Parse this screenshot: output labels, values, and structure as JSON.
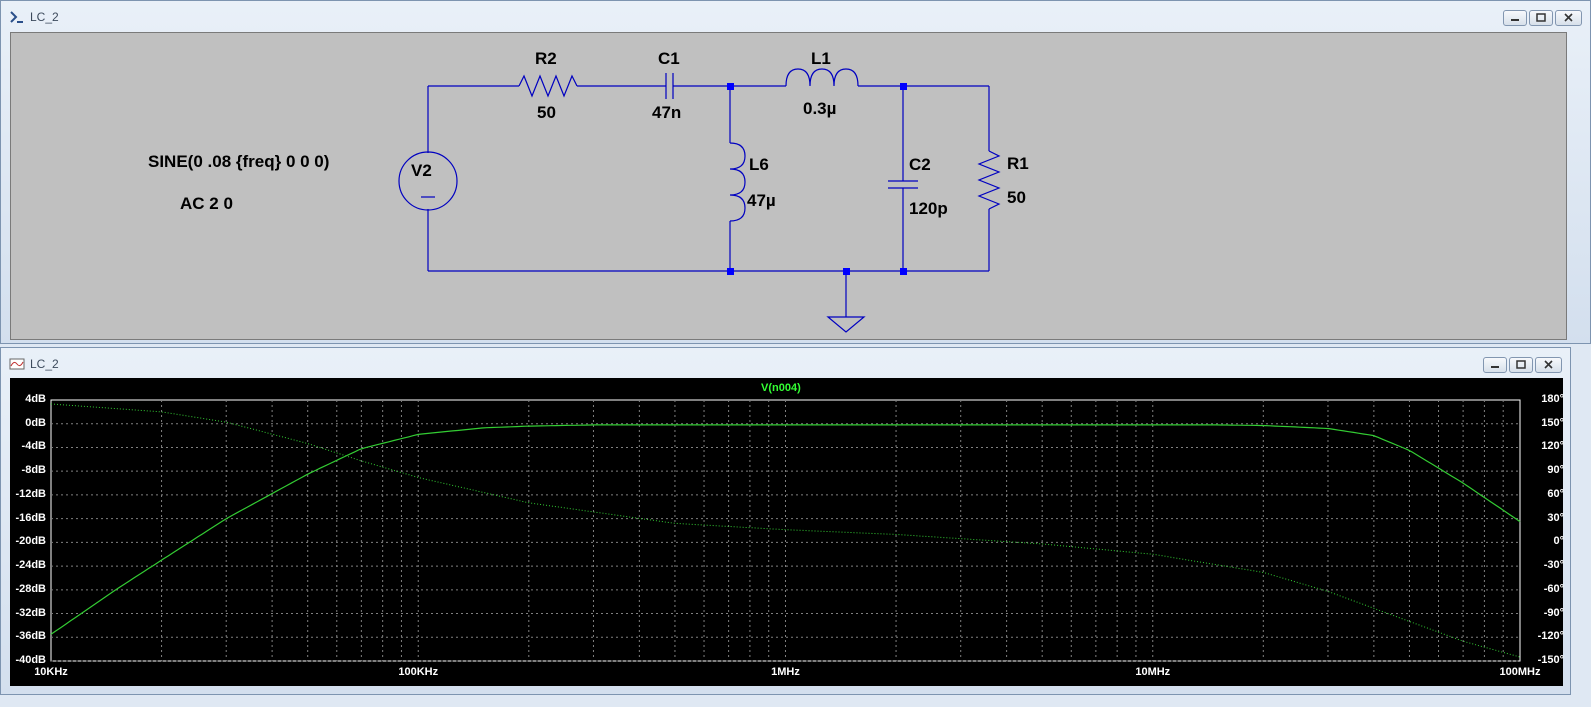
{
  "schematic_window": {
    "title": "LC_2",
    "source": {
      "ref": "V2",
      "sine": "SINE(0 .08 {freq} 0 0 0)",
      "ac": "AC 2 0"
    },
    "components": {
      "R2": {
        "ref": "R2",
        "value": "50"
      },
      "C1": {
        "ref": "C1",
        "value": "47n"
      },
      "L1": {
        "ref": "L1",
        "value": "0.3µ"
      },
      "L6": {
        "ref": "L6",
        "value": "47µ"
      },
      "C2": {
        "ref": "C2",
        "value": "120p"
      },
      "R1": {
        "ref": "R1",
        "value": "50"
      }
    },
    "wire_color": "#0000c0",
    "node_color": "#0000ff"
  },
  "waveform_window": {
    "title": "LC_2",
    "trace_label": "V(n004)",
    "trace_color": "#33cc33",
    "y_ticks": [
      "4dB",
      "0dB",
      "-4dB",
      "-8dB",
      "-12dB",
      "-16dB",
      "-20dB",
      "-24dB",
      "-28dB",
      "-32dB",
      "-36dB",
      "-40dB"
    ],
    "phase_ticks": [
      "180°",
      "150°",
      "120°",
      "90°",
      "60°",
      "30°",
      "0°",
      "-30°",
      "-60°",
      "-90°",
      "-120°",
      "-150°"
    ],
    "x_ticks": [
      "10KHz",
      "100KHz",
      "1MHz",
      "10MHz",
      "100MHz"
    ]
  },
  "chart_data": {
    "type": "line",
    "title": "V(n004)",
    "xscale": "log",
    "xlim": [
      10000,
      100000000
    ],
    "ylim": [
      -40,
      4
    ],
    "y2lim": [
      -150,
      180
    ],
    "grid": true,
    "series": [
      {
        "name": "V(n004)",
        "kind": "magnitude_dB",
        "style": "solid",
        "x": [
          10000,
          15000,
          20000,
          30000,
          50000,
          70000,
          100000,
          150000,
          200000,
          300000,
          500000,
          1000000,
          2000000,
          5000000,
          10000000,
          15000000,
          20000000,
          30000000,
          40000000,
          50000000,
          70000000,
          100000000
        ],
        "y": [
          -35.5,
          -28,
          -23,
          -16,
          -8.5,
          -4.2,
          -1.8,
          -0.7,
          -0.4,
          -0.2,
          -0.2,
          -0.2,
          -0.2,
          -0.2,
          -0.2,
          -0.2,
          -0.3,
          -0.8,
          -2,
          -4.5,
          -10,
          -16.5
        ]
      },
      {
        "name": "V(n004)",
        "kind": "phase_deg",
        "style": "dotted",
        "axis": "right",
        "x": [
          10000,
          20000,
          30000,
          50000,
          70000,
          100000,
          200000,
          500000,
          1000000,
          2000000,
          5000000,
          10000000,
          20000000,
          30000000,
          50000000,
          70000000,
          100000000
        ],
        "y": [
          175,
          165,
          152,
          125,
          103,
          82,
          50,
          24,
          16,
          10,
          -2,
          -15,
          -38,
          -62,
          -100,
          -125,
          -145
        ]
      }
    ]
  }
}
